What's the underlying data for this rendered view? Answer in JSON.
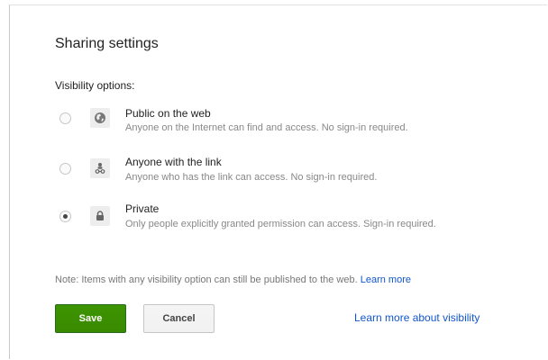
{
  "dialog": {
    "title": "Sharing settings",
    "section_label": "Visibility options:"
  },
  "options": [
    {
      "title": "Public on the web",
      "description": "Anyone on the Internet can find and access. No sign-in required.",
      "icon": "globe-icon",
      "selected": false
    },
    {
      "title": "Anyone with the link",
      "description": "Anyone who has the link can access. No sign-in required.",
      "icon": "people-link-icon",
      "selected": false
    },
    {
      "title": "Private",
      "description": "Only people explicitly granted permission can access. Sign-in required.",
      "icon": "lock-icon",
      "selected": true
    }
  ],
  "note": {
    "text": "Note: Items with any visibility option can still be published to the web.",
    "link": "Learn more"
  },
  "buttons": {
    "save": "Save",
    "cancel": "Cancel"
  },
  "learn_more_visibility": "Learn more about visibility",
  "colors": {
    "save_button": "#3d9400",
    "link": "#1155cc"
  }
}
